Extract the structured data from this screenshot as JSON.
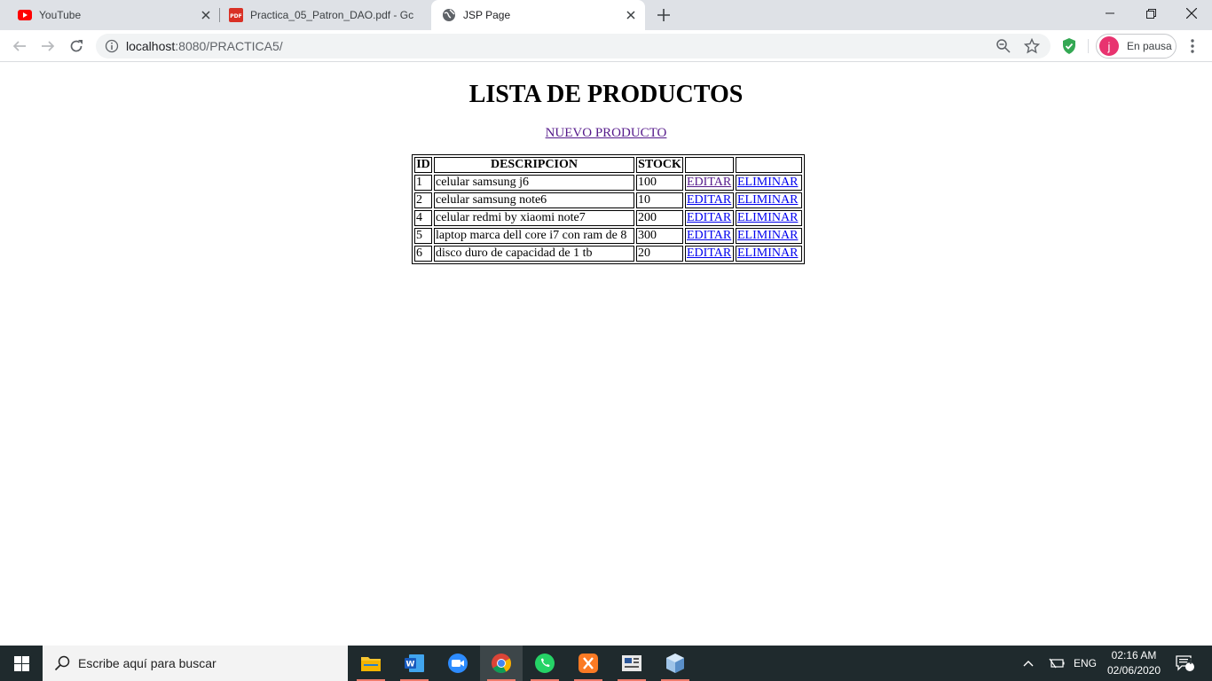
{
  "browser": {
    "tabs": [
      {
        "title": "YouTube",
        "icon": "youtube-icon",
        "active": false
      },
      {
        "title": "Practica_05_Patron_DAO.pdf - Gc",
        "icon": "pdf-icon",
        "active": false
      },
      {
        "title": "JSP Page",
        "icon": "globe-icon",
        "active": true
      }
    ],
    "url_host": "localhost",
    "url_path": ":8080/PRACTICA5/",
    "profile_label": "En pausa",
    "profile_initial": "j"
  },
  "page": {
    "heading": "LISTA DE PRODUCTOS",
    "new_link": "NUEVO PRODUCTO",
    "table": {
      "headers": [
        "ID",
        "DESCRIPCION",
        "STOCK",
        "",
        ""
      ],
      "rows": [
        {
          "id": "1",
          "descripcion": "celular samsung j6",
          "stock": "100",
          "edit": "EDITAR",
          "delete": "ELIMINAR"
        },
        {
          "id": "2",
          "descripcion": "celular samsung note6",
          "stock": "10",
          "edit": "EDITAR",
          "delete": "ELIMINAR"
        },
        {
          "id": "4",
          "descripcion": "celular redmi by xiaomi note7",
          "stock": "200",
          "edit": "EDITAR",
          "delete": "ELIMINAR"
        },
        {
          "id": "5",
          "descripcion": "laptop marca dell core i7 con ram de 8",
          "stock": "300",
          "edit": "EDITAR",
          "delete": "ELIMINAR"
        },
        {
          "id": "6",
          "descripcion": "disco duro de capacidad de 1 tb",
          "stock": "20",
          "edit": "EDITAR",
          "delete": "ELIMINAR"
        }
      ]
    }
  },
  "taskbar": {
    "search_placeholder": "Escribe aquí para buscar",
    "apps": [
      "file-explorer-icon",
      "word-icon",
      "zoom-icon",
      "chrome-icon",
      "whatsapp-icon",
      "xampp-icon",
      "news-icon",
      "virtualbox-icon"
    ],
    "language": "ENG",
    "time": "02:16 AM",
    "date": "02/06/2020",
    "notification_count": "4"
  },
  "colors": {
    "link": "#0000ee",
    "visited_link": "#551a8b",
    "tabstrip": "#dee1e6",
    "taskbar": "#1f2a2d"
  }
}
